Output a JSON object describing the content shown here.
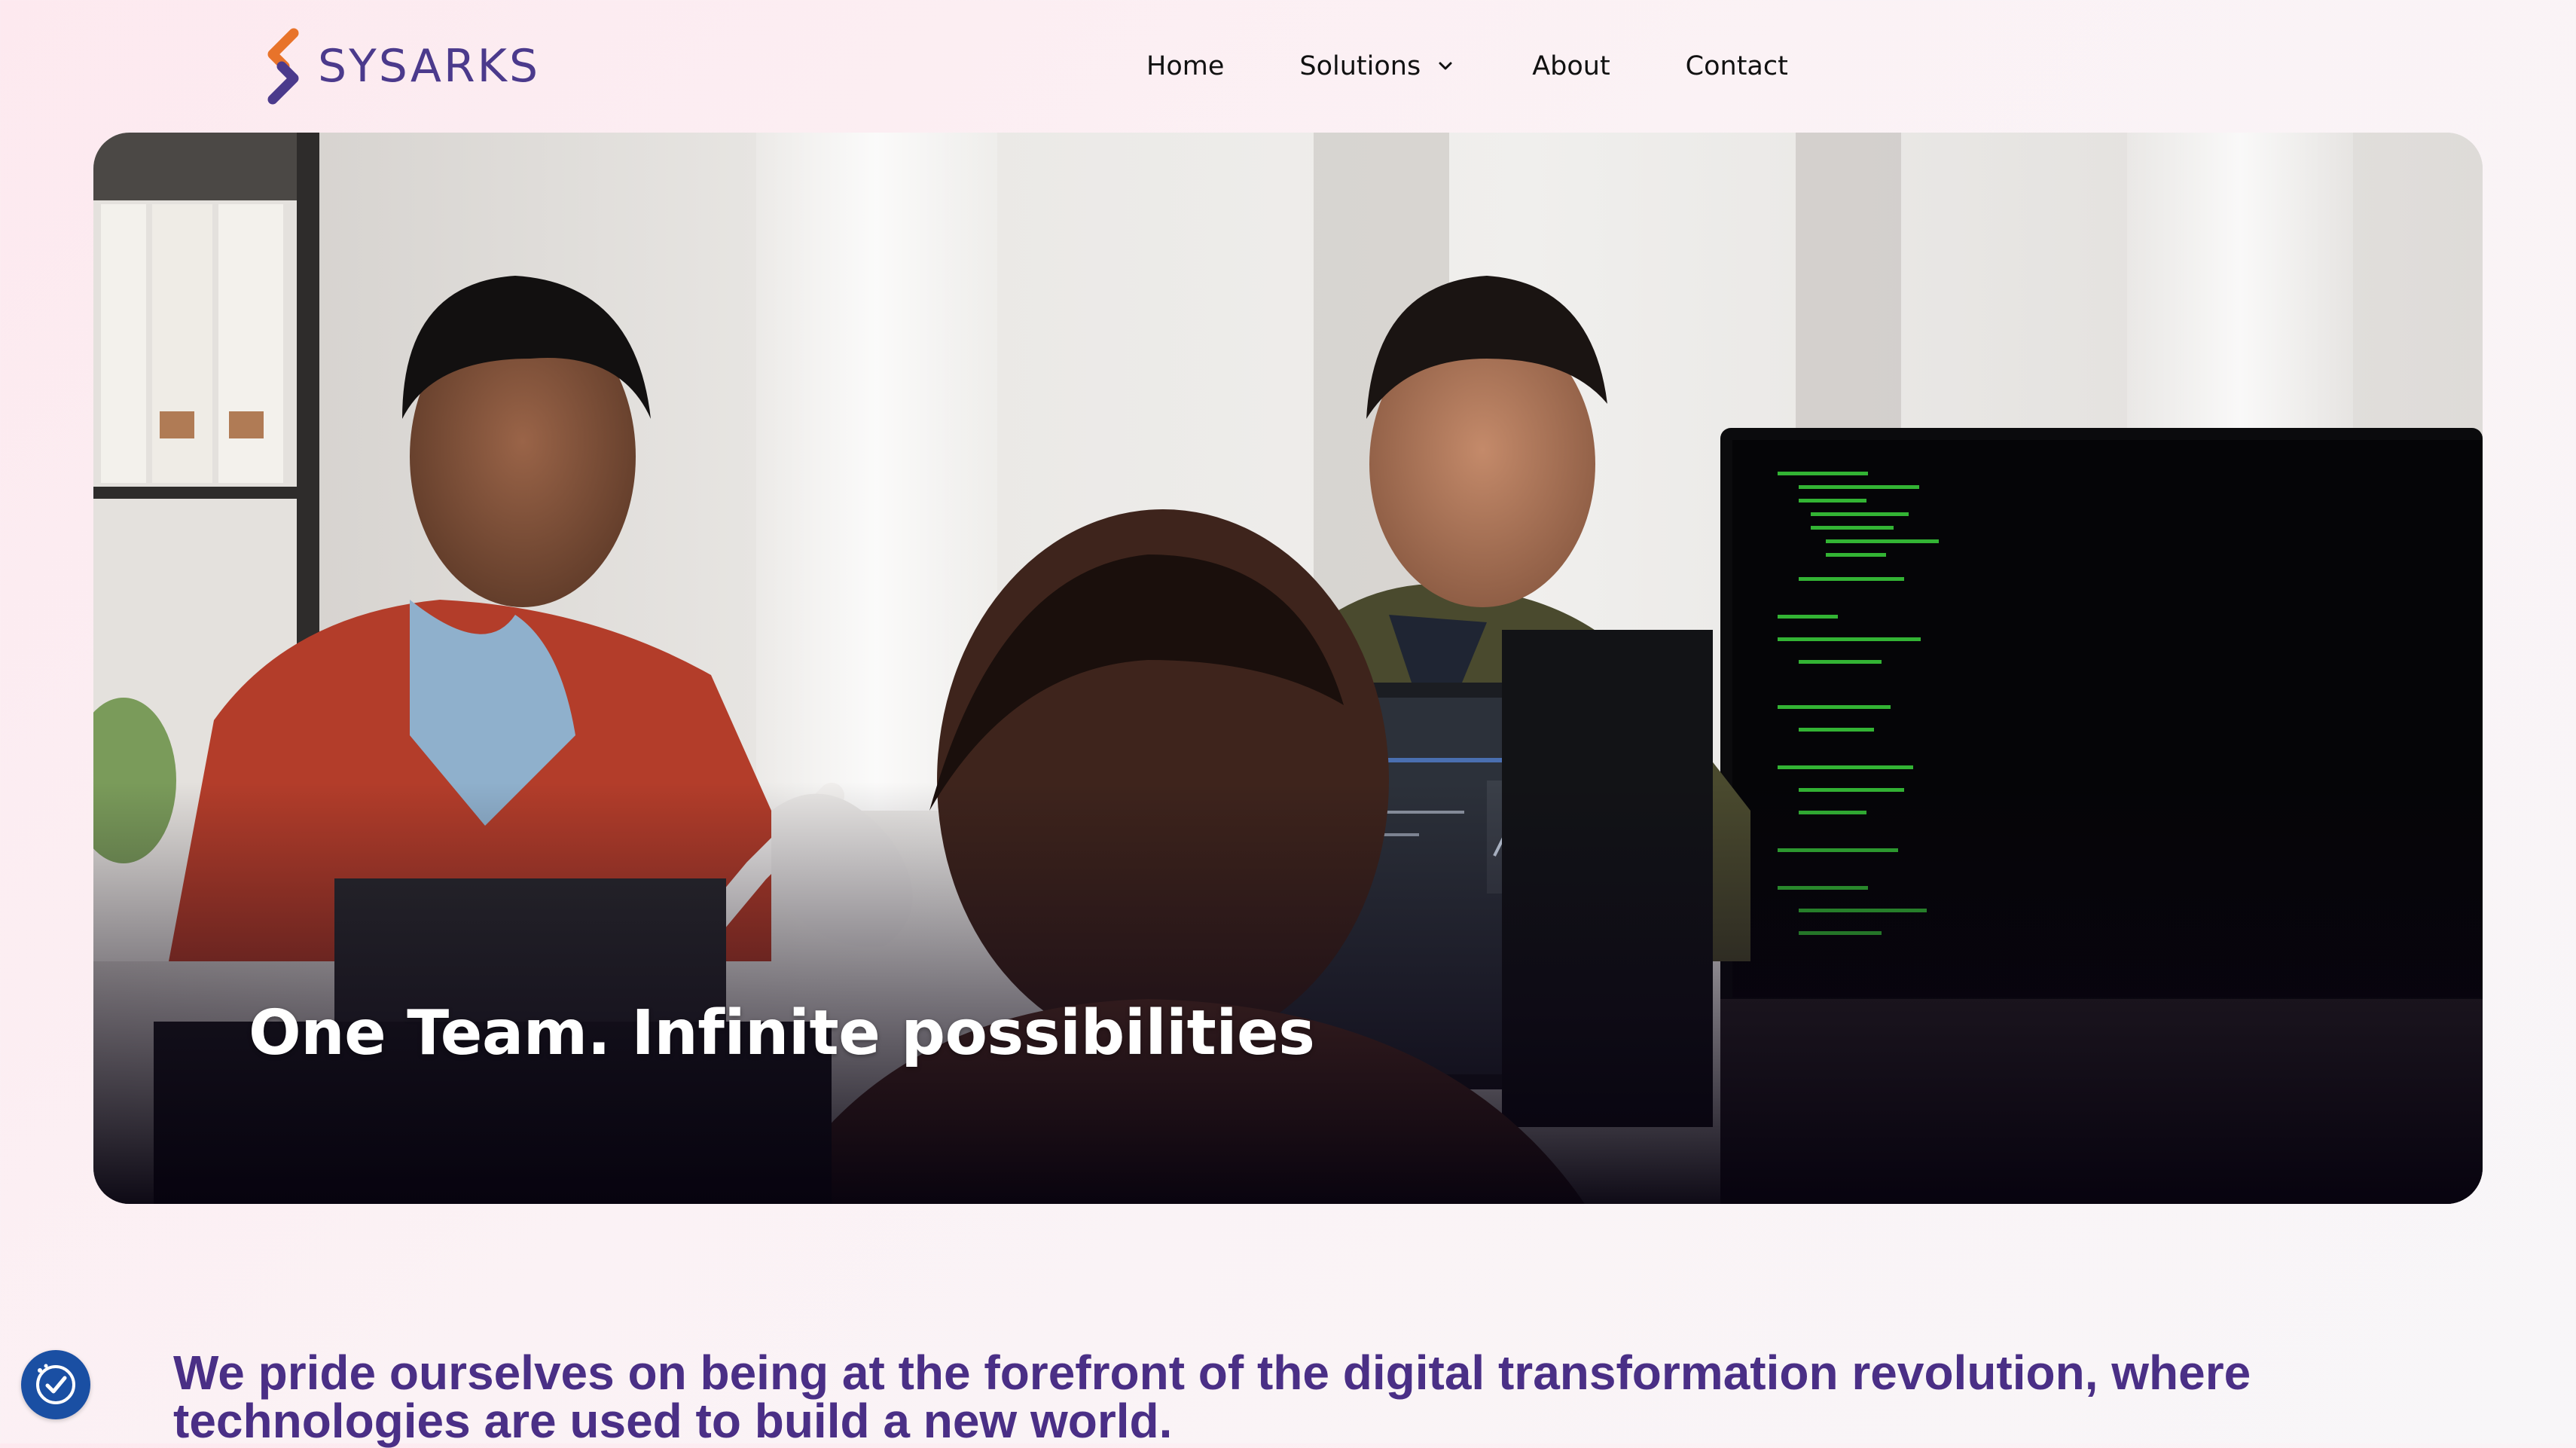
{
  "header": {
    "brand": "SYSARKS",
    "nav": [
      {
        "label": "Home"
      },
      {
        "label": "Solutions",
        "icon": "chevron-down-icon"
      },
      {
        "label": "About"
      },
      {
        "label": "Contact"
      }
    ]
  },
  "hero": {
    "heading": "One Team. Infinite possibilities"
  },
  "intro": {
    "text": "We pride ourselves on being at the forefront of the digital transformation revolution, where technologies are used to build a new world."
  },
  "accessibility": {
    "icon": "accessibility-icon"
  },
  "colors": {
    "brand_purple": "#4b3a8c",
    "brand_orange": "#e8732a",
    "intro_text": "#4a2f86",
    "accessibility_button": "#1a4fa3"
  }
}
